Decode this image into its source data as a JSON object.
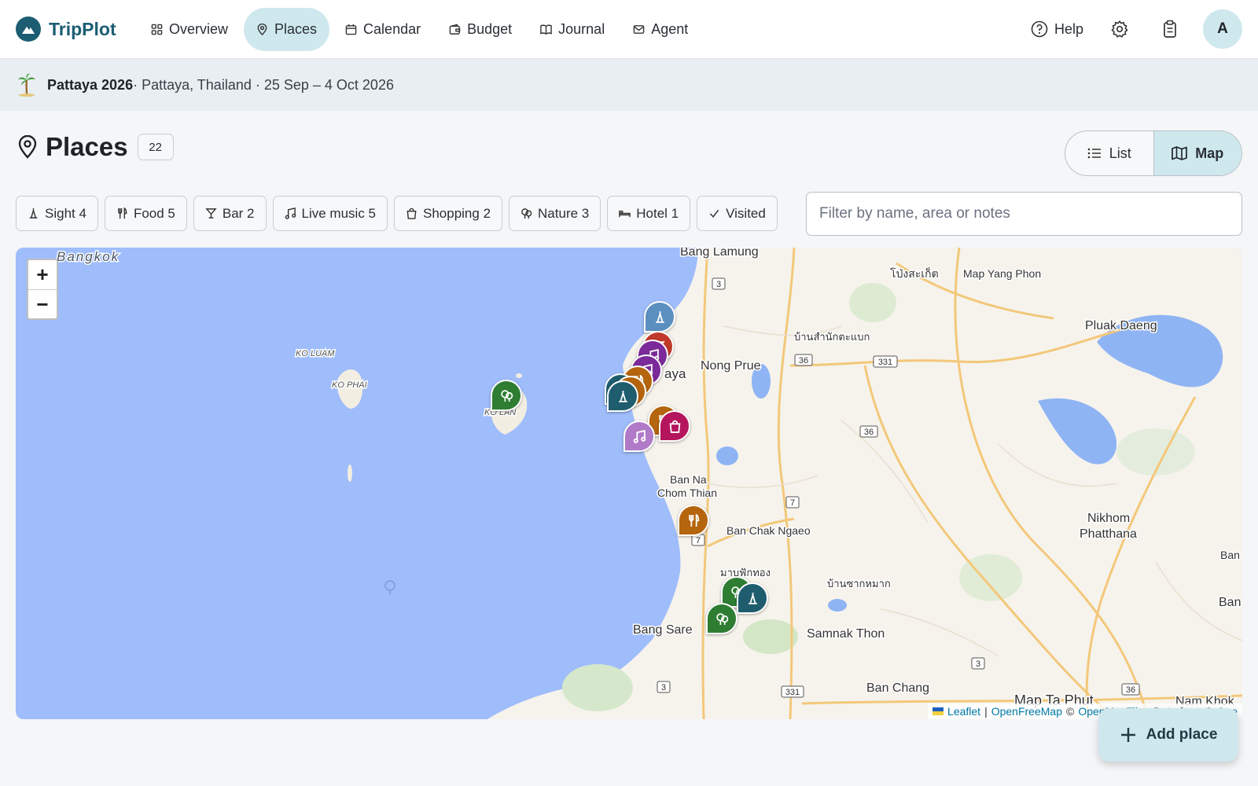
{
  "app": {
    "name": "TripPlot",
    "brand_color": "#1c5d73",
    "accent_color": "#cfe8ee"
  },
  "nav": {
    "items": [
      {
        "label": "Overview",
        "icon": "grid-icon"
      },
      {
        "label": "Places",
        "icon": "location-pin-icon",
        "active": true
      },
      {
        "label": "Calendar",
        "icon": "calendar-icon"
      },
      {
        "label": "Budget",
        "icon": "wallet-icon"
      },
      {
        "label": "Journal",
        "icon": "book-icon"
      },
      {
        "label": "Agent",
        "icon": "mail-icon"
      }
    ],
    "help_label": "Help",
    "avatar_initial": "A"
  },
  "trip": {
    "emoji": "palm-tree-icon",
    "name": "Pattaya 2026",
    "details": " · Pattaya, Thailand · 25 Sep – 4 Oct 2026"
  },
  "page": {
    "title": "Places",
    "count": "22"
  },
  "view_toggle": {
    "list_label": "List",
    "map_label": "Map",
    "selected": "Map"
  },
  "filters": [
    {
      "label": "Sight 4",
      "icon": "landmark-icon"
    },
    {
      "label": "Food 5",
      "icon": "fork-knife-icon"
    },
    {
      "label": "Bar 2",
      "icon": "cocktail-icon"
    },
    {
      "label": "Live music 5",
      "icon": "music-note-icon"
    },
    {
      "label": "Shopping 2",
      "icon": "shopping-bag-icon"
    },
    {
      "label": "Nature 3",
      "icon": "tree-icon"
    },
    {
      "label": "Hotel 1",
      "icon": "bed-icon"
    },
    {
      "label": "Visited",
      "icon": "check-icon"
    }
  ],
  "search": {
    "placeholder": "Filter by name, area or notes",
    "value": ""
  },
  "map": {
    "zoom_in": "+",
    "zoom_out": "−",
    "labels": {
      "bangkok": "Bangkok",
      "bang_lamung": "Bang Lamung",
      "pong_sakoet": "โป่งสะเก็ต",
      "map_yang_phon": "Map Yang Phon",
      "pluak_daeng": "Pluak Daeng",
      "ban_samnak_maek": "บ้านสำนักตะแบก",
      "nong_prue": "Nong Prue",
      "pattaya_partial": "aya",
      "ko_luam": "KO LUAM",
      "ko_phai": "KO PHAI",
      "ko_lan": "KO LAN",
      "ban_na": "Ban Na",
      "chom_thian": "Chom Thian",
      "ban_chak_ngaeo": "Ban Chak Ngaeo",
      "nikhom": "Nikhom",
      "phatthana": "Phatthana",
      "ban_right_1": "Ban",
      "ban_right_2": "Ban",
      "map_fak_thong": "มาบฟักทอง",
      "ban_sak_mak": "บ้านซากหมาก",
      "bang_sare": "Bang Sare",
      "samnak_thon": "Samnak Thon",
      "ban_chang": "Ban Chang",
      "map_ta_phut": "Map Ta Phut",
      "nam_khok": "Nam Khok"
    },
    "road_shields": [
      "3",
      "36",
      "331",
      "36",
      "7",
      "7",
      "3",
      "331",
      "3",
      "36"
    ],
    "attribution": {
      "leaflet": "Leaflet",
      "sep": "|",
      "openfreemap": "OpenFreeMap",
      "copy": "©",
      "openmaptiles": "OpenMapTiles",
      "data_from": "Data from ©",
      "osm": "Ope"
    },
    "category_colors": {
      "sight": "#1f5d6e",
      "sight_light": "#5b8fbf",
      "food": "#b5650d",
      "live_music": "#7b2a99",
      "live_music_light": "#b07ac8",
      "shopping": "#b5155c",
      "nature": "#2e7d32",
      "bar": "#c0392b"
    }
  },
  "fab": {
    "label": "Add place",
    "icon": "plus-icon"
  }
}
